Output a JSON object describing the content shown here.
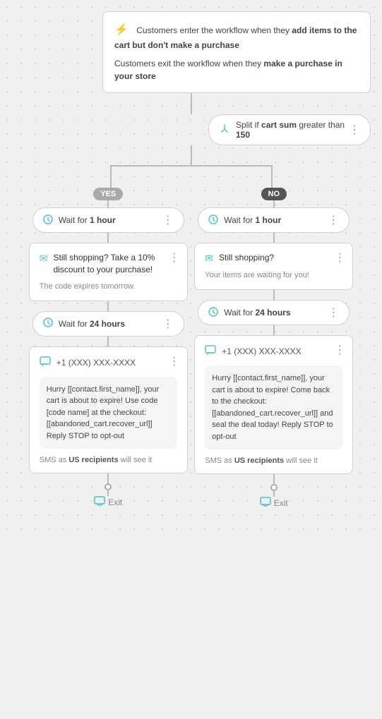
{
  "trigger": {
    "icon": "⚡",
    "text1_prefix": "Customers enter the workflow when they ",
    "text1_bold": "add items to the cart but don't make a purchase",
    "text2_prefix": "Customers exit the workflow when they ",
    "text2_bold": "make a purchase in your store"
  },
  "split_node": {
    "icon": "⚡",
    "label_prefix": "Split if ",
    "label_bold1": "cart sum",
    "label_middle": " greater than ",
    "label_bold2": "150",
    "more": "⋮"
  },
  "branches": {
    "yes_label": "YES",
    "no_label": "NO"
  },
  "yes_branch": {
    "wait1": {
      "label_prefix": "Wait for ",
      "label_bold": "1 hour",
      "more": "⋮"
    },
    "email": {
      "title": "Still shopping? Take a 10% discount to your purchase!",
      "body": "The code expires tomorrow.",
      "more": "⋮"
    },
    "wait2": {
      "label_prefix": "Wait for ",
      "label_bold": "24 hours",
      "more": "⋮"
    },
    "sms": {
      "number": "+1 (XXX) XXX-XXXX",
      "message": "Hurry [[contact.first_name]], your cart is about to expire! Use code [code name] at the checkout: [[abandoned_cart.recover_url]] Reply STOP to opt-out",
      "footer_prefix": "SMS as ",
      "footer_bold": "US recipients",
      "footer_suffix": " will see it",
      "more": "⋮"
    },
    "exit_label": "Exit"
  },
  "no_branch": {
    "wait1": {
      "label_prefix": "Wait for ",
      "label_bold": "1 hour",
      "more": "⋮"
    },
    "email": {
      "title": "Still shopping?",
      "body": "Your items are waiting for you!",
      "more": "⋮"
    },
    "wait2": {
      "label_prefix": "Wait for ",
      "label_bold": "24 hours",
      "more": "⋮"
    },
    "sms": {
      "number": "+1 (XXX) XXX-XXXX",
      "message": "Hurry [[contact.first_name]], your cart is about to expire! Come back to the checkout: [[abandoned_cart.recover_url]] and seal the deal today! Reply STOP to opt-out",
      "footer_prefix": "SMS as ",
      "footer_bold": "US recipients",
      "footer_suffix": " will see it",
      "more": "⋮"
    },
    "exit_label": "Exit"
  }
}
